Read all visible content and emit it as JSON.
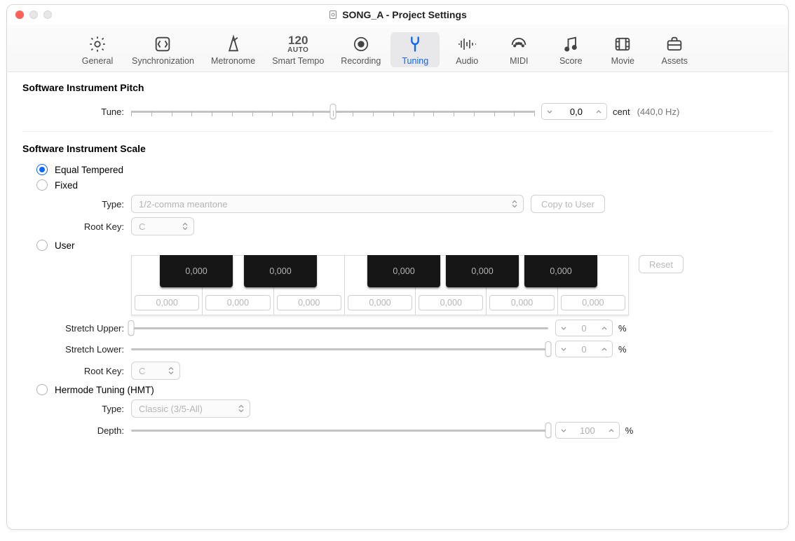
{
  "window": {
    "title": "SONG_A - Project Settings"
  },
  "toolbar": {
    "items": [
      {
        "label": "General"
      },
      {
        "label": "Synchronization"
      },
      {
        "label": "Metronome"
      },
      {
        "label": "Smart Tempo",
        "top": "120",
        "bot": "AUTO"
      },
      {
        "label": "Recording"
      },
      {
        "label": "Tuning"
      },
      {
        "label": "Audio"
      },
      {
        "label": "MIDI"
      },
      {
        "label": "Score"
      },
      {
        "label": "Movie"
      },
      {
        "label": "Assets"
      }
    ]
  },
  "pitch": {
    "section": "Software Instrument Pitch",
    "tune_label": "Tune:",
    "value": "0,0",
    "unit": "cent",
    "ref": "(440,0 Hz)"
  },
  "scale": {
    "section": "Software Instrument Scale",
    "equal_tempered": "Equal Tempered",
    "fixed": "Fixed",
    "user": "User",
    "hermode": "Hermode Tuning (HMT)",
    "type_label": "Type:",
    "type_value": "1/2-comma meantone",
    "copy_to_user": "Copy to User",
    "root_key_label": "Root Key:",
    "root_key_value": "C",
    "reset": "Reset",
    "keyboard": {
      "white": [
        "0,000",
        "0,000",
        "0,000",
        "0,000",
        "0,000",
        "0,000",
        "0,000"
      ],
      "black": [
        "0,000",
        "0,000",
        "0,000",
        "0,000",
        "0,000"
      ]
    },
    "stretch_upper_label": "Stretch Upper:",
    "stretch_upper_value": "0",
    "stretch_lower_label": "Stretch Lower:",
    "stretch_lower_value": "0",
    "root_key2_label": "Root Key:",
    "root_key2_value": "C",
    "hmt_type_label": "Type:",
    "hmt_type_value": "Classic (3/5-All)",
    "depth_label": "Depth:",
    "depth_value": "100",
    "percent": "%"
  }
}
